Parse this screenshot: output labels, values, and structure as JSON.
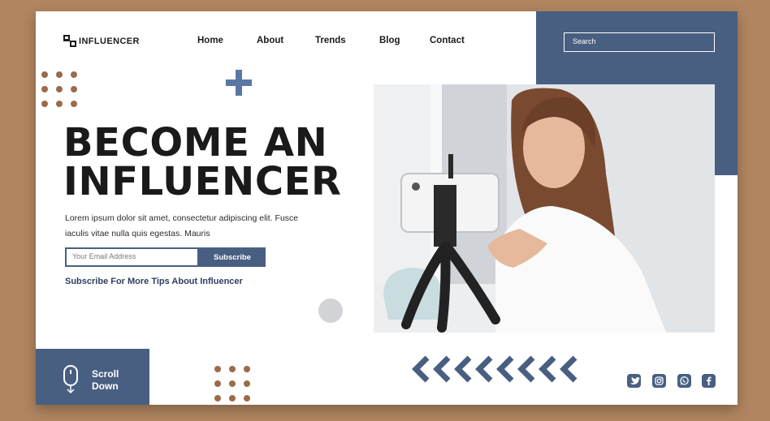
{
  "header": {
    "brand": "INFLUENCER",
    "nav": [
      "Home",
      "About",
      "Trends",
      "Blog",
      "Contact"
    ],
    "search_placeholder": "Search"
  },
  "hero": {
    "headline_line1": "BECOME AN",
    "headline_line2": "INFLUENCER",
    "paragraph": "Lorem ipsum dolor sit amet, consectetur adipiscing elit. Fusce iaculis vitae nulla quis egestas. Mauris",
    "email_placeholder": "Your Email Address",
    "subscribe_label": "Subscribe",
    "tagline": "Subscribe For More Tips About Influencer"
  },
  "scroll": {
    "line1": "Scroll",
    "line2": "Down"
  },
  "social": [
    "twitter-icon",
    "instagram-icon",
    "whatsapp-icon",
    "facebook-icon"
  ],
  "colors": {
    "background": "#b08560",
    "accent_blue": "#485f82",
    "dot_brown": "#9c6a4a",
    "plus_blue": "#5a77a3"
  }
}
